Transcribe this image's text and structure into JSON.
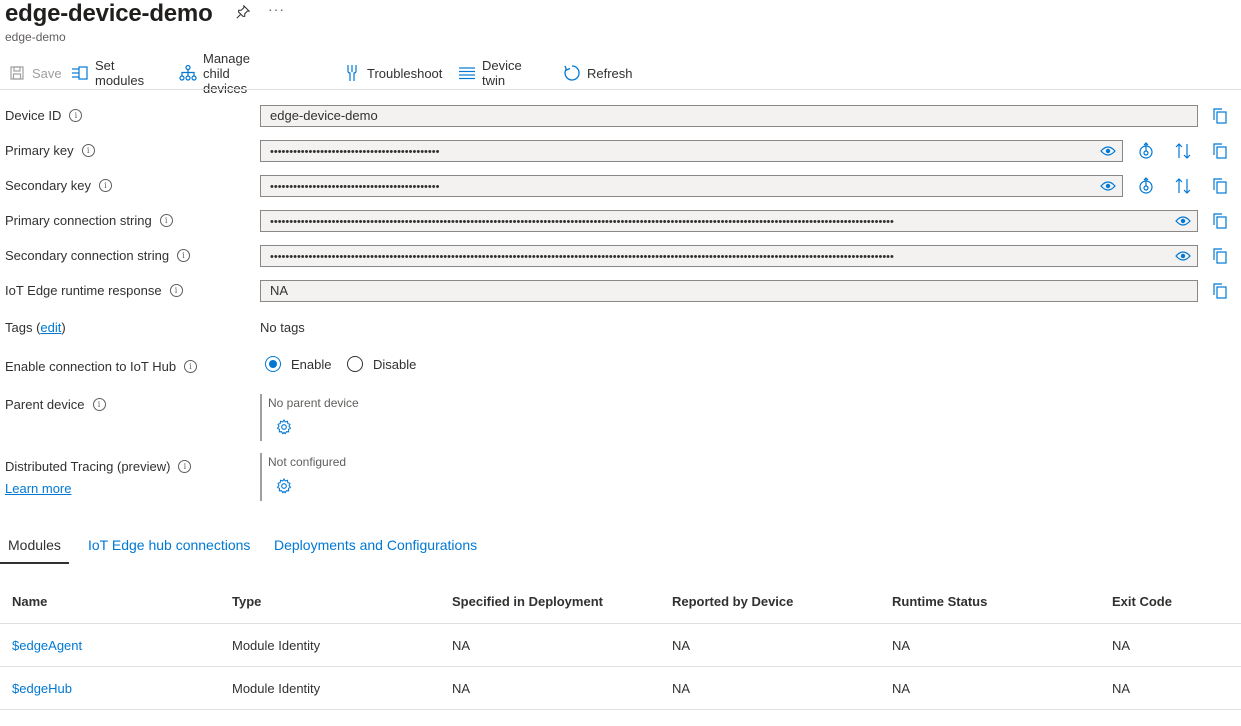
{
  "header": {
    "title": "edge-device-demo",
    "subtitle": "edge-demo",
    "more": "···"
  },
  "toolbar": {
    "save": "Save",
    "set_modules": "Set modules",
    "manage_child": "Manage child devices",
    "troubleshoot": "Troubleshoot",
    "device_twin": "Device twin",
    "refresh": "Refresh"
  },
  "fields": {
    "device_id": {
      "label": "Device ID",
      "value": "edge-device-demo"
    },
    "primary_key": {
      "label": "Primary key",
      "value": "••••••••••••••••••••••••••••••••••••••••••••"
    },
    "secondary_key": {
      "label": "Secondary key",
      "value": "••••••••••••••••••••••••••••••••••••••••••••"
    },
    "primary_conn": {
      "label": "Primary connection string",
      "value": "••••••••••••••••••••••••••••••••••••••••••••••••••••••••••••••••••••••••••••••••••••••••••••••••••••••••••••••••••••••••••••••••••••••••••••••••••••••••••••••••••"
    },
    "secondary_conn": {
      "label": "Secondary connection string",
      "value": "••••••••••••••••••••••••••••••••••••••••••••••••••••••••••••••••••••••••••••••••••••••••••••••••••••••••••••••••••••••••••••••••••••••••••••••••••••••••••••••••••"
    },
    "runtime_response": {
      "label": "IoT Edge runtime response",
      "value": "NA"
    }
  },
  "tags": {
    "label_prefix": "Tags (",
    "edit": "edit",
    "label_suffix": ")",
    "value": "No tags"
  },
  "connection": {
    "label": "Enable connection to IoT Hub",
    "enable": "Enable",
    "disable": "Disable",
    "selected": "Enable"
  },
  "parent": {
    "label": "Parent device",
    "value": "No parent device"
  },
  "tracing": {
    "label": "Distributed Tracing (preview)",
    "learn_more": "Learn more",
    "value": "Not configured"
  },
  "tabs": [
    "Modules",
    "IoT Edge hub connections",
    "Deployments and Configurations"
  ],
  "table": {
    "columns": [
      "Name",
      "Type",
      "Specified in Deployment",
      "Reported by Device",
      "Runtime Status",
      "Exit Code"
    ],
    "rows": [
      [
        "$edgeAgent",
        "Module Identity",
        "NA",
        "NA",
        "NA",
        "NA"
      ],
      [
        "$edgeHub",
        "Module Identity",
        "NA",
        "NA",
        "NA",
        "NA"
      ]
    ]
  },
  "colors": {
    "accent": "#0078d4",
    "text": "#323130",
    "field_bg": "#f3f2f1",
    "border": "#8a8886"
  }
}
